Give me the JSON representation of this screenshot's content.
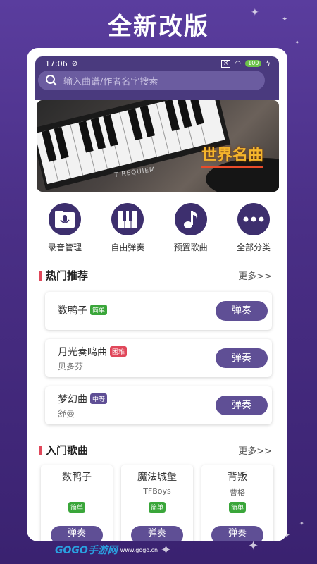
{
  "promo": {
    "title": "全新改版"
  },
  "status": {
    "time": "17:06",
    "battery": "100"
  },
  "search": {
    "placeholder": "输入曲谱/作者名字搜索"
  },
  "banner": {
    "text": "世界名曲",
    "sub_text": "T REQUIEM"
  },
  "categories": [
    {
      "label": "录音管理",
      "icon": "mic-folder-icon"
    },
    {
      "label": "自由弹奏",
      "icon": "piano-keys-icon"
    },
    {
      "label": "预置歌曲",
      "icon": "music-note-icon"
    },
    {
      "label": "全部分类",
      "icon": "more-dots-icon"
    }
  ],
  "hot": {
    "title": "热门推荐",
    "more": "更多>>",
    "items": [
      {
        "name": "数鸭子",
        "artist": "",
        "difficulty": "简单",
        "difficulty_color": "#3aa63a",
        "play": "弹奏"
      },
      {
        "name": "月光奏鸣曲",
        "artist": "贝多芬",
        "difficulty": "困难",
        "difficulty_color": "#e0475a",
        "play": "弹奏"
      },
      {
        "name": "梦幻曲",
        "artist": "舒曼",
        "difficulty": "中等",
        "difficulty_color": "#5f4f95",
        "play": "弹奏"
      }
    ]
  },
  "beginner": {
    "title": "入门歌曲",
    "more": "更多>>",
    "items": [
      {
        "name": "数鸭子",
        "artist": "",
        "difficulty": "简单",
        "play": "弹奏"
      },
      {
        "name": "魔法城堡",
        "artist": "TFBoys",
        "difficulty": "简单",
        "play": "弹奏"
      },
      {
        "name": "背叛",
        "artist": "曹格",
        "difficulty": "简单",
        "play": "弹奏"
      }
    ]
  },
  "watermark": {
    "logo": "GOGO手游网",
    "site": "www.gogo.cn"
  },
  "colors": {
    "accent": "#5f4f95",
    "header": "#4a3a7e",
    "easy": "#3aa63a"
  }
}
